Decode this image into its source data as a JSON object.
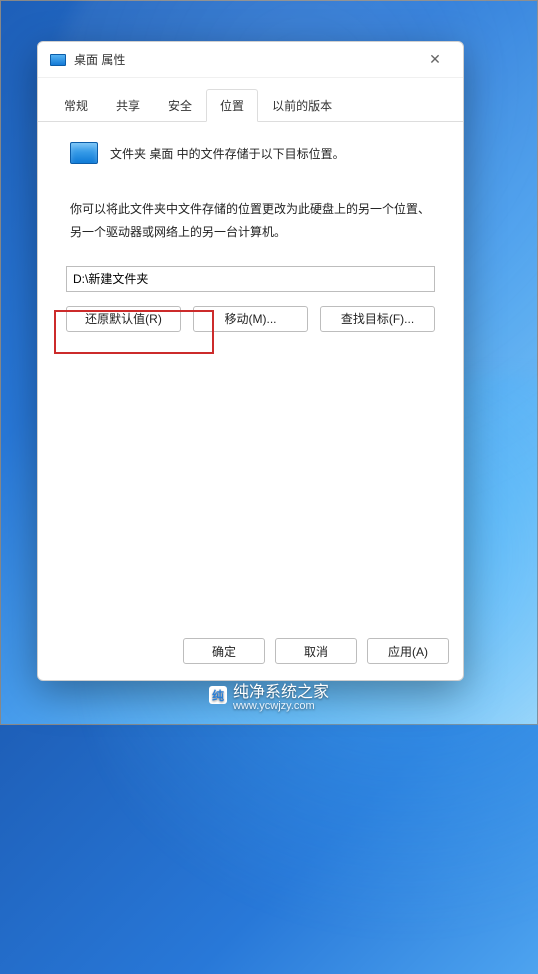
{
  "window": {
    "title": "桌面 属性",
    "close_glyph": "✕"
  },
  "tabs": {
    "general": "常规",
    "sharing": "共享",
    "security": "安全",
    "location": "位置",
    "previous": "以前的版本"
  },
  "content": {
    "folder_line": "文件夹 桌面 中的文件存储于以下目标位置。",
    "description": "你可以将此文件夹中文件存储的位置更改为此硬盘上的另一个位置、另一个驱动器或网络上的另一台计算机。",
    "path_value": "D:\\新建文件夹",
    "restore_btn": "还原默认值(R)",
    "move_btn": "移动(M)...",
    "find_btn": "查找目标(F)..."
  },
  "footer": {
    "ok": "确定",
    "cancel": "取消",
    "apply": "应用(A)"
  },
  "watermark": {
    "text": "纯净系统之家",
    "url": "www.ycwjzy.com"
  }
}
